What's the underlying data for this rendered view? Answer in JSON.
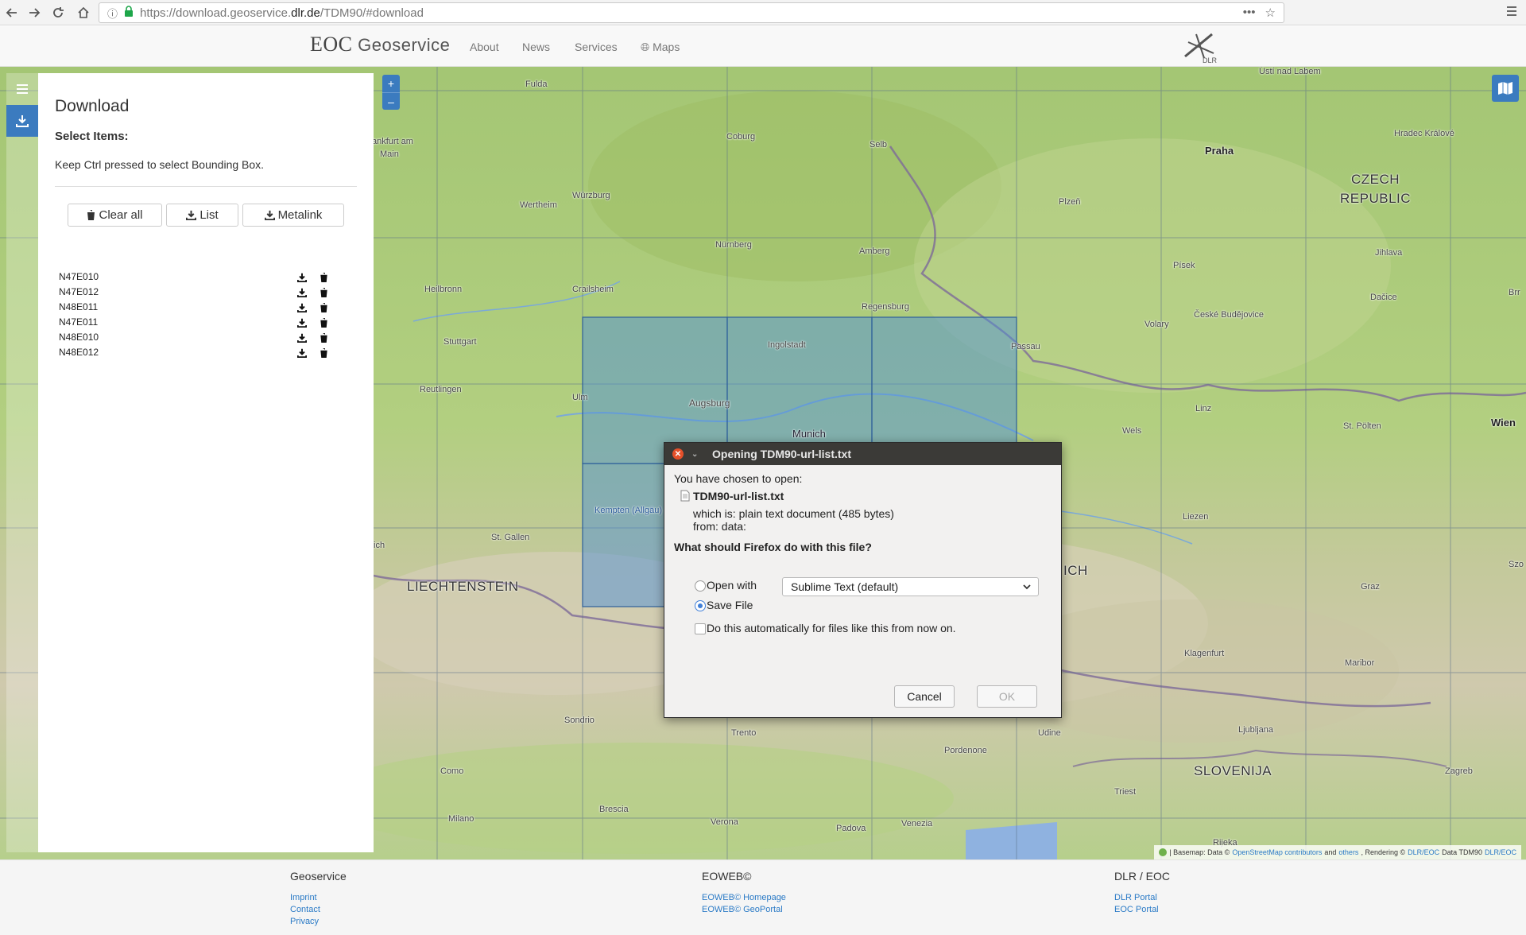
{
  "browser": {
    "url_prefix": "https://download.geoservice.",
    "url_host": "dlr.de",
    "url_path": "/TDM90/#download"
  },
  "site": {
    "brand_eoc": "EOC",
    "brand_name": "Geoservice",
    "nav": [
      "About",
      "News",
      "Services",
      "Maps"
    ],
    "dlr_logo_text": "DLR"
  },
  "sidebar": {
    "title": "Download",
    "subtitle": "Select Items:",
    "hint": "Keep Ctrl pressed to select Bounding Box.",
    "buttons": {
      "clear_all": "Clear all",
      "list": "List",
      "metalink": "Metalink"
    },
    "tiles": [
      "N47E010",
      "N47E012",
      "N48E011",
      "N47E011",
      "N48E010",
      "N48E012"
    ]
  },
  "map": {
    "zoom_in": "+",
    "zoom_out": "–",
    "labels": {
      "praha": "Praha",
      "czech1": "CZECH",
      "czech2": "REPUBLIC",
      "liechtenstein": "LIECHTENSTEIN",
      "slovenija": "SLOVENIJA",
      "wien": "Wien",
      "munich": "Munich",
      "augsburg": "Augsburg",
      "ingolstadt": "Ingolstadt",
      "nurnberg": "Nürnberg",
      "regensburg": "Regensburg",
      "stuttgart": "Stuttgart",
      "heilbronn": "Heilbronn",
      "reutlingen": "Reutlingen",
      "ulm": "Ulm",
      "wurzburg": "Würzburg",
      "wertheim": "Wertheim",
      "fulda": "Fulda",
      "frankfurt1": "ankfurt am",
      "frankfurt2": "Main",
      "coburg": "Coburg",
      "selb": "Selb",
      "plzen": "Plzeň",
      "amberg": "Amberg",
      "pisek": "Písek",
      "jihlava": "Jihlava",
      "hradec": "Hradec Králové",
      "usti": "Ústí nad Labem",
      "budejovice": "České Budějovice",
      "dacice": "Dačice",
      "volary": "Volary",
      "passau": "Passau",
      "linz": "Linz",
      "stpolten": "St. Pölten",
      "wels": "Wels",
      "liezen": "Liezen",
      "graz": "Graz",
      "klagenfurt": "Klagenfurt",
      "maribor": "Maribor",
      "ljubljana": "Ljubljana",
      "triest": "Triest",
      "rijeka": "Rijeka",
      "zagreb": "Zagreb",
      "udine": "Udine",
      "pordenone": "Pordenone",
      "venezia": "Venezia",
      "padova": "Padova",
      "verona": "Verona",
      "brescia": "Brescia",
      "milano": "Milano",
      "como": "Como",
      "trento": "Trento",
      "sondrio": "Sondrio",
      "kempten": "Kempten (Allgäu)",
      "stgallen": "St. Gallen",
      "crailsheim": "Crailsheim",
      "ich": "ich",
      "rich": "ICH",
      "szc": "Szo",
      "brr": "Brr"
    },
    "attribution": {
      "prefix": "| Basemap: Data ©",
      "osm": "OpenStreetMap contributors",
      "and": "and",
      "others": "others",
      "rendering": ", Rendering ©",
      "dlr": "DLR/EOC",
      "data": "Data TDM90",
      "dlr2": "DLR/EOC"
    }
  },
  "dialog": {
    "title": "Opening TDM90-url-list.txt",
    "chosen": "You have chosen to open:",
    "filename": "TDM90-url-list.txt",
    "which_is": "which is:  plain text document (485 bytes)",
    "from": "from:  data:",
    "question": "What should Firefox do with this file?",
    "open_with": "Open with",
    "open_with_app": "Sublime Text (default)",
    "save_file": "Save File",
    "auto": "Do this automatically for files like this from now on.",
    "cancel": "Cancel",
    "ok": "OK"
  },
  "footer": {
    "col1": {
      "title": "Geoservice",
      "links": [
        "Imprint",
        "Contact",
        "Privacy"
      ]
    },
    "col2": {
      "title": "EOWEB©",
      "links": [
        "EOWEB© Homepage",
        "EOWEB© GeoPortal"
      ]
    },
    "col3": {
      "title": "DLR / EOC",
      "links": [
        "DLR Portal",
        "EOC Portal"
      ]
    }
  }
}
